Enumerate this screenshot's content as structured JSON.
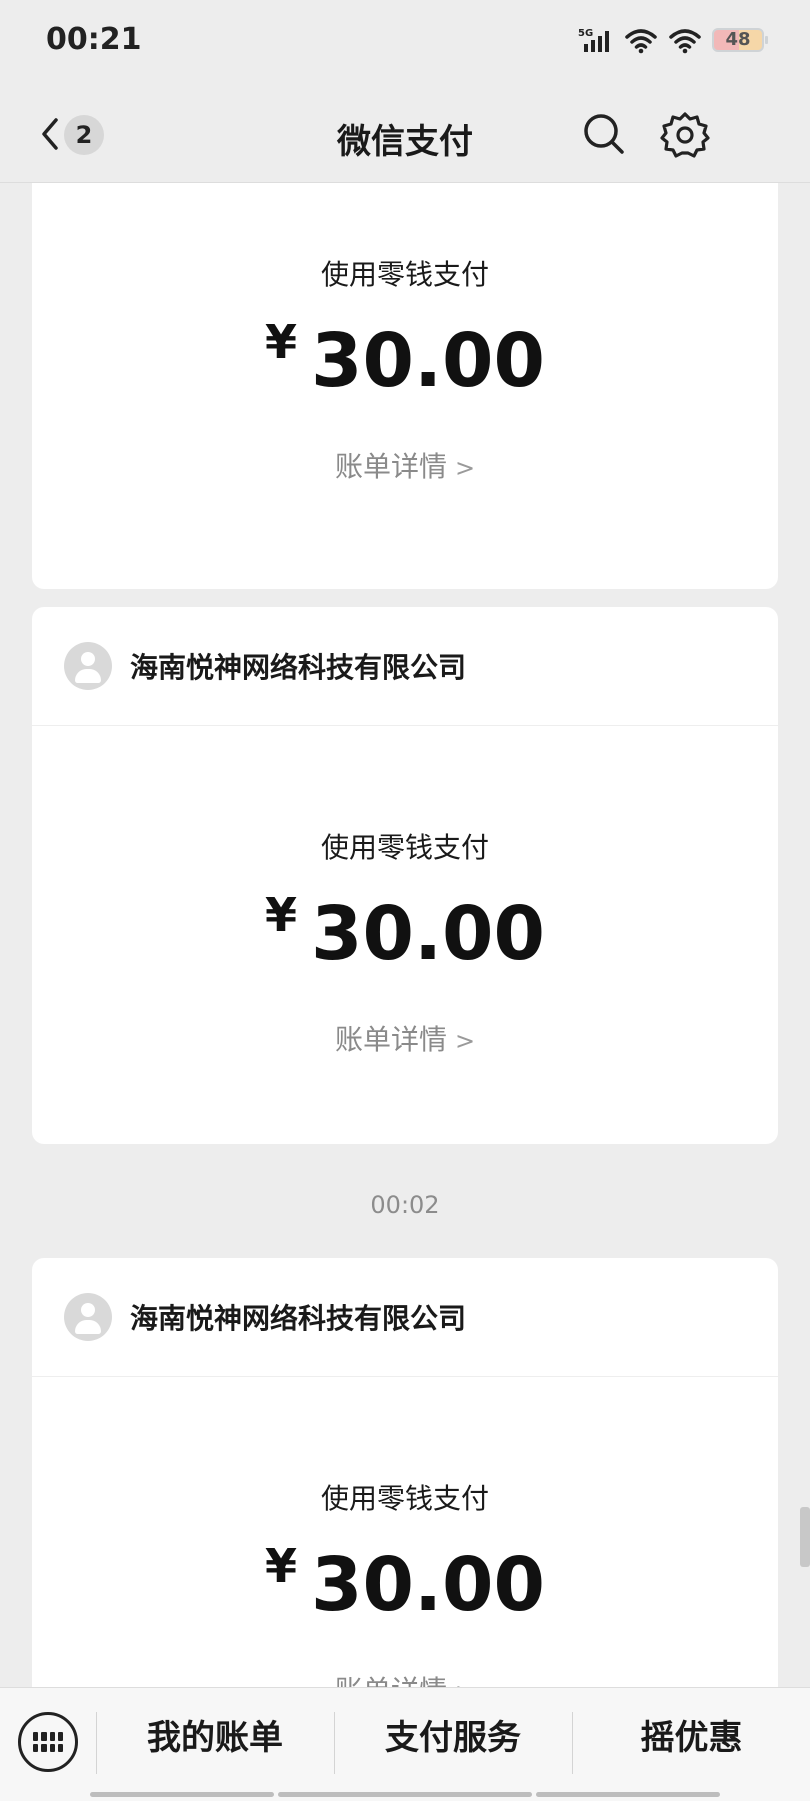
{
  "status": {
    "time": "00:21",
    "network": "5G",
    "battery": "48"
  },
  "nav": {
    "unread_count": "2",
    "title": "微信支付"
  },
  "cards": [
    {
      "merchant": "",
      "pay_label": "使用零钱支付",
      "currency": "¥",
      "amount": "30.00",
      "detail_link": "账单详情"
    },
    {
      "merchant": "海南悦神网络科技有限公司",
      "pay_label": "使用零钱支付",
      "currency": "¥",
      "amount": "30.00",
      "detail_link": "账单详情"
    },
    {
      "merchant": "海南悦神网络科技有限公司",
      "pay_label": "使用零钱支付",
      "currency": "¥",
      "amount": "30.00",
      "detail_link": "账单详情"
    }
  ],
  "timestamp": "00:02",
  "bottom_tabs": [
    "我的账单",
    "支付服务",
    "摇优惠"
  ],
  "icons": [
    "back-icon",
    "search-icon",
    "gear-icon",
    "keyboard-icon",
    "signal-icon",
    "wifi-icon",
    "battery-icon",
    "avatar-icon",
    "chevron-right-icon"
  ]
}
